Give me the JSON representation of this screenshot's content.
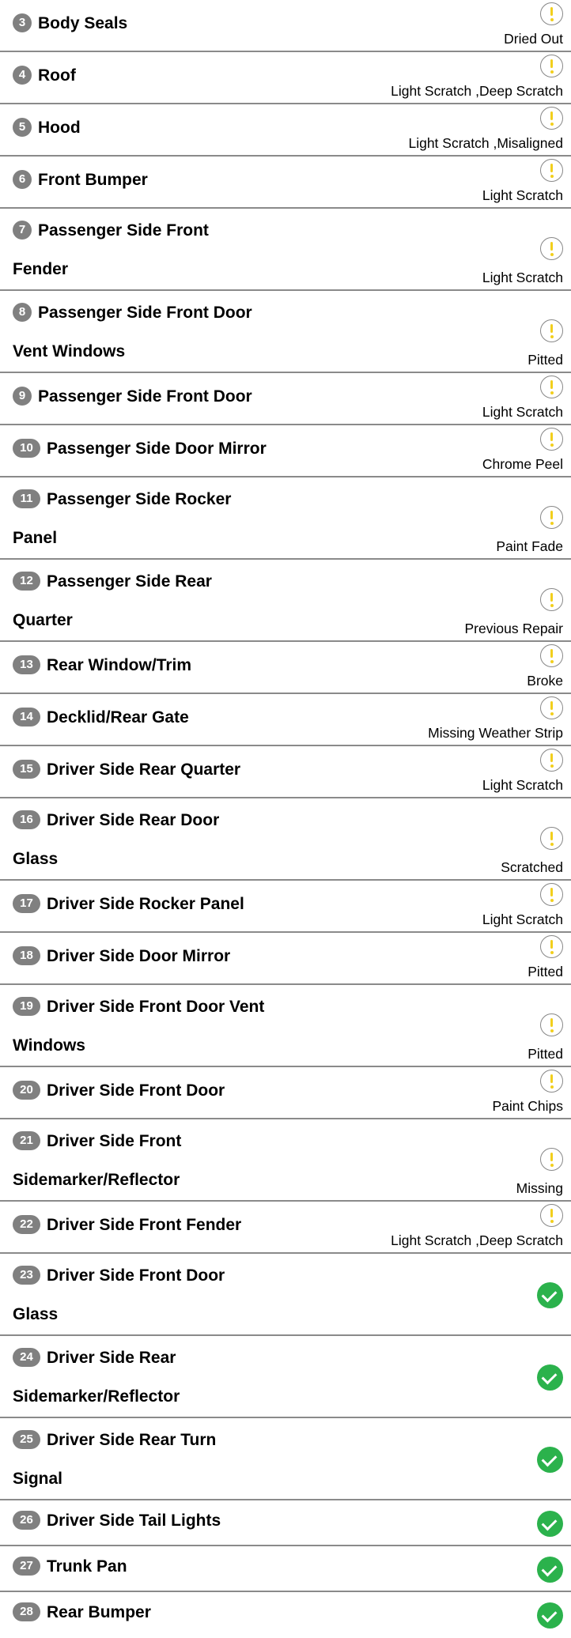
{
  "items": [
    {
      "num": "3",
      "title": "Body Seals",
      "status_type": "warning",
      "status": "Dried Out"
    },
    {
      "num": "4",
      "title": "Roof",
      "status_type": "warning",
      "status": "Light Scratch ,Deep Scratch"
    },
    {
      "num": "5",
      "title": "Hood",
      "status_type": "warning",
      "status": "Light Scratch ,Misaligned"
    },
    {
      "num": "6",
      "title": "Front Bumper",
      "status_type": "warning",
      "status": "Light Scratch"
    },
    {
      "num": "7",
      "title": "Passenger Side Front",
      "title2": "Fender",
      "status_type": "warning",
      "status": "Light Scratch"
    },
    {
      "num": "8",
      "title": "Passenger Side Front Door",
      "title2": "Vent Windows",
      "status_type": "warning",
      "status": "Pitted"
    },
    {
      "num": "9",
      "title": "Passenger Side Front Door",
      "status_type": "warning",
      "status": "Light Scratch"
    },
    {
      "num": "10",
      "title": "Passenger Side Door Mirror",
      "status_type": "warning",
      "status": "Chrome Peel"
    },
    {
      "num": "11",
      "title": "Passenger Side Rocker",
      "title2": "Panel",
      "status_type": "warning",
      "status": "Paint Fade"
    },
    {
      "num": "12",
      "title": "Passenger Side Rear",
      "title2": "Quarter",
      "status_type": "warning",
      "status": "Previous Repair"
    },
    {
      "num": "13",
      "title": "Rear Window/Trim",
      "status_type": "warning",
      "status": "Broke"
    },
    {
      "num": "14",
      "title": "Decklid/Rear Gate",
      "status_type": "warning",
      "status": "Missing Weather Strip"
    },
    {
      "num": "15",
      "title": "Driver Side Rear Quarter",
      "status_type": "warning",
      "status": "Light Scratch"
    },
    {
      "num": "16",
      "title": "Driver Side Rear Door",
      "title2": "Glass",
      "status_type": "warning",
      "status": "Scratched"
    },
    {
      "num": "17",
      "title": "Driver Side Rocker Panel",
      "status_type": "warning",
      "status": "Light Scratch"
    },
    {
      "num": "18",
      "title": "Driver Side Door Mirror",
      "status_type": "warning",
      "status": "Pitted"
    },
    {
      "num": "19",
      "title": "Driver Side Front Door Vent",
      "title2": "Windows",
      "status_type": "warning",
      "status": "Pitted"
    },
    {
      "num": "20",
      "title": "Driver Side Front Door",
      "status_type": "warning",
      "status": "Paint Chips"
    },
    {
      "num": "21",
      "title": "Driver Side Front",
      "title2": "Sidemarker/Reflector",
      "status_type": "warning",
      "status": "Missing"
    },
    {
      "num": "22",
      "title": "Driver Side Front Fender",
      "status_type": "warning",
      "status": "Light Scratch ,Deep Scratch"
    },
    {
      "num": "23",
      "title": "Driver Side Front Door",
      "title2": "Glass",
      "status_type": "ok"
    },
    {
      "num": "24",
      "title": "Driver Side Rear",
      "title2": "Sidemarker/Reflector",
      "status_type": "ok"
    },
    {
      "num": "25",
      "title": "Driver Side Rear Turn",
      "title2": "Signal",
      "status_type": "ok"
    },
    {
      "num": "26",
      "title": "Driver Side Tail Lights",
      "status_type": "ok"
    },
    {
      "num": "27",
      "title": "Trunk Pan",
      "status_type": "ok"
    },
    {
      "num": "28",
      "title": "Rear Bumper",
      "status_type": "ok"
    }
  ],
  "colors": {
    "badge": "#808080",
    "warning": "#f2cf1d",
    "ok": "#2bb24c",
    "divider": "#8a8a8a"
  }
}
